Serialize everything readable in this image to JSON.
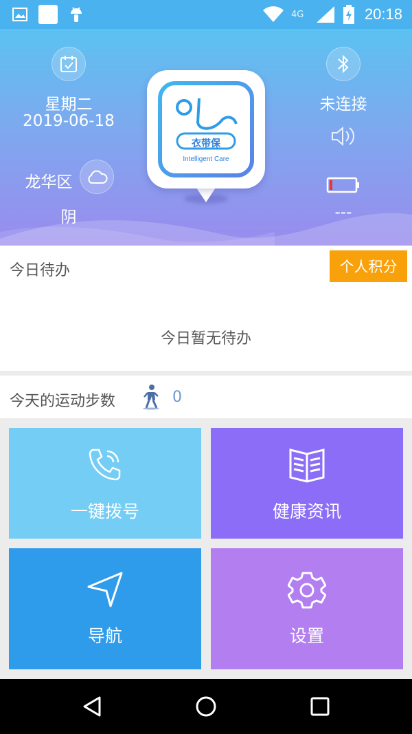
{
  "status_bar": {
    "time": "20:18",
    "network_label": "4G",
    "icons": [
      "image-icon",
      "square-icon",
      "android-icon",
      "wifi-icon",
      "signal-icon",
      "battery-charging-icon"
    ]
  },
  "header": {
    "weekday": "星期二",
    "date": "2019-06-18",
    "district": "龙华区",
    "weather": "阴",
    "bluetooth_status": "未连接",
    "battery_text": "---",
    "logo": {
      "brand_cn": "衣带保",
      "brand_en": "Intelligent Care"
    }
  },
  "todo": {
    "title": "今日待办",
    "points_button": "个人积分",
    "empty_text": "今日暂无待办"
  },
  "steps": {
    "label": "今天的运动步数",
    "value": "0"
  },
  "tiles": [
    {
      "label": "一键拨号",
      "icon": "phone-icon",
      "color": "#73cdf4"
    },
    {
      "label": "健康资讯",
      "icon": "book-icon",
      "color": "#8b6df7"
    },
    {
      "label": "导航",
      "icon": "navigation-icon",
      "color": "#2f9beb"
    },
    {
      "label": "设置",
      "icon": "gear-icon",
      "color": "#b27ef0"
    }
  ],
  "nav_bar": {
    "buttons": [
      "back-icon",
      "home-icon",
      "recents-icon"
    ]
  },
  "colors": {
    "status_bar": "#4ab2ee",
    "header_top": "#5bc2f1",
    "header_bottom": "#9a8bee",
    "points_button": "#f9a10a",
    "steps_value": "#6f97d2"
  }
}
